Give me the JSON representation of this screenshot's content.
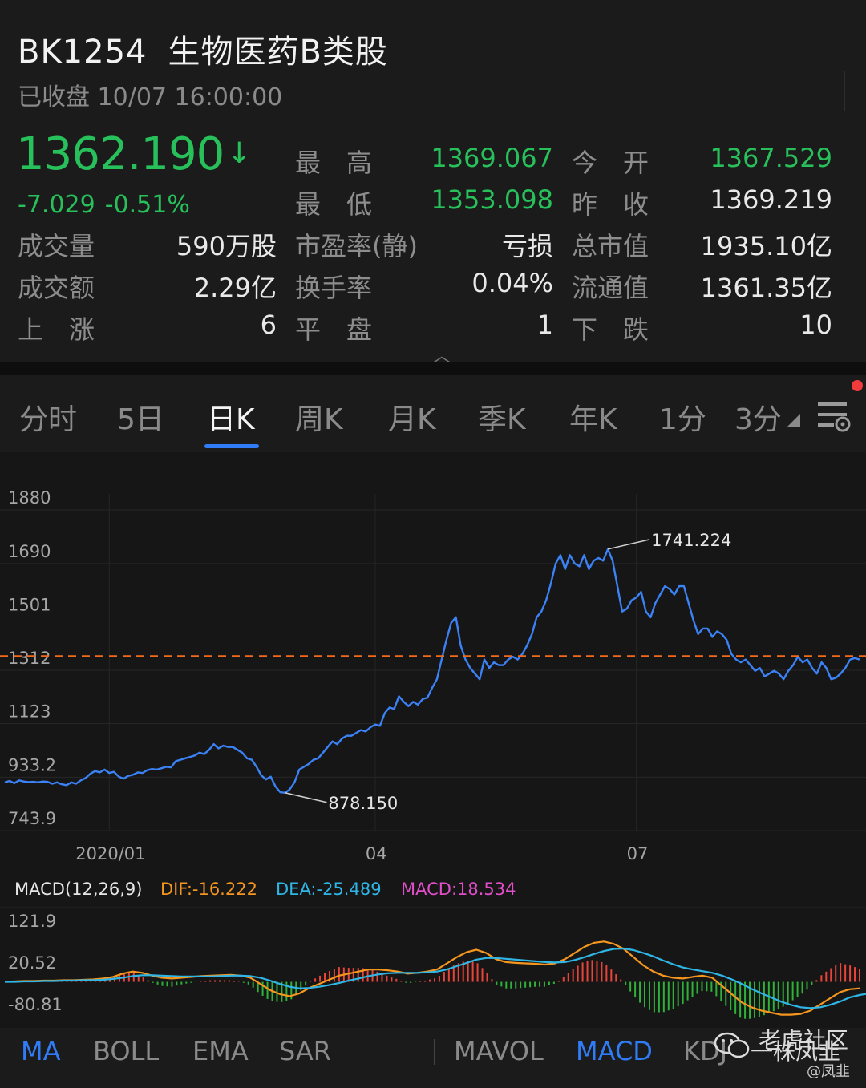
{
  "header": {
    "code": "BK1254",
    "name": "生物医药B类股",
    "status": "已收盘 10/07 16:00:00",
    "price": "1362.190",
    "price_arrow": "↓",
    "change": "-7.029",
    "change_pct": "-0.51%"
  },
  "stats": {
    "high_label": "最　高",
    "high": "1369.067",
    "open_label": "今　开",
    "open": "1367.529",
    "low_label": "最　低",
    "low": "1353.098",
    "prev_label": "昨　收",
    "prev": "1369.219",
    "vol_label": "成交量",
    "vol": "590万股",
    "pe_label": "市盈率(静)",
    "pe": "亏损",
    "mcap_label": "总市值",
    "mcap": "1935.10亿",
    "amt_label": "成交额",
    "amt": "2.29亿",
    "turn_label": "换手率",
    "turn": "0.04%",
    "float_label": "流通值",
    "float": "1361.35亿",
    "up_label": "上　涨",
    "up": "6",
    "flat_label": "平　盘",
    "flat": "1",
    "down_label": "下　跌",
    "down": "10",
    "expand_icon": "chevron-up-icon"
  },
  "tabs": [
    "分时",
    "5日",
    "日K",
    "周K",
    "月K",
    "季K",
    "年K",
    "1分",
    "3分"
  ],
  "tabs_active": "日K",
  "tabs_more_icon": "triangle-icon",
  "settings_icon": "settings-icon",
  "notification_dot_color": "#f23c3c",
  "colors": {
    "green": "#27c05a",
    "price_line": "#3b82f6",
    "dashed": "#f26b1d",
    "dif": "#f5961e",
    "dea": "#2fb6e6",
    "macd_pos": "#e8443a",
    "macd_neg": "#2fb13a",
    "accent": "#2f7cf6"
  },
  "chart_data": [
    {
      "type": "line",
      "y_ticks": [
        "1880",
        "1690",
        "1501",
        "1312",
        "1123",
        "933.2",
        "743.9"
      ],
      "ylim": [
        743.9,
        1880
      ],
      "x_ticks": [
        "2020/01",
        "04",
        "07"
      ],
      "current_price": 1362.19,
      "annotations": [
        {
          "label": "1741.224",
          "type": "max"
        },
        {
          "label": "878.150",
          "type": "min"
        }
      ],
      "series": [
        {
          "values": [
            915,
            920,
            912,
            922,
            918,
            916,
            917,
            915,
            918,
            917,
            910,
            915,
            908,
            905,
            915,
            910,
            922,
            930,
            945,
            955,
            950,
            960,
            948,
            952,
            935,
            928,
            938,
            942,
            950,
            948,
            958,
            962,
            960,
            965,
            970,
            968,
            990,
            995,
            1000,
            1005,
            1010,
            1020,
            1015,
            1030,
            1050,
            1035,
            1045,
            1040,
            1040,
            1030,
            1020,
            1000,
            995,
            970,
            940,
            925,
            935,
            900,
            880,
            878,
            890,
            915,
            960,
            970,
            980,
            995,
            1000,
            1020,
            1040,
            1060,
            1050,
            1070,
            1080,
            1080,
            1090,
            1100,
            1095,
            1110,
            1120,
            1115,
            1160,
            1180,
            1175,
            1220,
            1200,
            1185,
            1200,
            1190,
            1210,
            1215,
            1250,
            1280,
            1350,
            1420,
            1480,
            1500,
            1400,
            1350,
            1320,
            1300,
            1280,
            1350,
            1320,
            1340,
            1330,
            1330,
            1350,
            1360,
            1350,
            1370,
            1400,
            1440,
            1500,
            1520,
            1560,
            1620,
            1690,
            1720,
            1670,
            1720,
            1690,
            1680,
            1720,
            1670,
            1700,
            1710,
            1700,
            1741.224,
            1700,
            1610,
            1520,
            1530,
            1560,
            1570,
            1590,
            1520,
            1500,
            1550,
            1580,
            1610,
            1600,
            1580,
            1610,
            1610,
            1550,
            1490,
            1440,
            1460,
            1460,
            1430,
            1450,
            1440,
            1420,
            1370,
            1350,
            1340,
            1350,
            1330,
            1310,
            1320,
            1290,
            1300,
            1310,
            1300,
            1280,
            1310,
            1330,
            1360,
            1340,
            1350,
            1320,
            1300,
            1340,
            1320,
            1280,
            1285,
            1300,
            1320,
            1350,
            1355,
            1350
          ]
        }
      ]
    },
    {
      "type": "line",
      "title": "MACD(12,26,9)",
      "legend": [
        "DIF:-16.222",
        "DEA:-25.489",
        "MACD:18.534"
      ],
      "y_ticks": [
        "121.9",
        "20.52",
        "-80.81"
      ],
      "ylim": [
        -80.81,
        121.9
      ],
      "series": [
        {
          "name": "DIF",
          "values": [
            0,
            1,
            2,
            2,
            3,
            3,
            4,
            4,
            5,
            6,
            8,
            12,
            20,
            25,
            22,
            15,
            10,
            8,
            10,
            12,
            14,
            15,
            16,
            17,
            15,
            10,
            -5,
            -20,
            -30,
            -35,
            -28,
            -15,
            -5,
            5,
            15,
            20,
            25,
            30,
            30,
            28,
            25,
            20,
            22,
            25,
            30,
            45,
            60,
            72,
            78,
            70,
            55,
            48,
            46,
            45,
            44,
            42,
            45,
            55,
            70,
            85,
            95,
            98,
            92,
            80,
            60,
            40,
            25,
            15,
            10,
            8,
            12,
            15,
            10,
            -10,
            -30,
            -50,
            -62,
            -70,
            -75,
            -80,
            -80,
            -78,
            -70,
            -55,
            -40,
            -25,
            -18,
            -16
          ]
        },
        {
          "name": "DEA",
          "values": [
            0,
            0,
            1,
            1,
            2,
            2,
            3,
            3,
            4,
            4,
            5,
            7,
            10,
            14,
            16,
            16,
            15,
            14,
            13,
            13,
            13,
            13,
            14,
            15,
            15,
            14,
            10,
            3,
            -5,
            -12,
            -16,
            -15,
            -12,
            -8,
            -3,
            3,
            8,
            14,
            18,
            21,
            22,
            22,
            22,
            23,
            25,
            30,
            38,
            46,
            54,
            58,
            58,
            56,
            54,
            52,
            50,
            48,
            47,
            48,
            53,
            60,
            68,
            75,
            80,
            81,
            77,
            70,
            62,
            52,
            43,
            35,
            30,
            26,
            22,
            15,
            6,
            -5,
            -17,
            -28,
            -38,
            -48,
            -56,
            -62,
            -64,
            -62,
            -56,
            -48,
            -38,
            -32,
            -28,
            -25.5
          ]
        }
      ]
    }
  ],
  "indicators": [
    "MA",
    "BOLL",
    "EMA",
    "SAR",
    "MAVOL",
    "MACD",
    "KDJ"
  ],
  "indicators_active": [
    "MA",
    "MACD"
  ],
  "watermark": {
    "line1": "老虎社区",
    "line2": "一株凤韭",
    "handle": "@凤韭",
    "icon": "wechat-icon"
  }
}
